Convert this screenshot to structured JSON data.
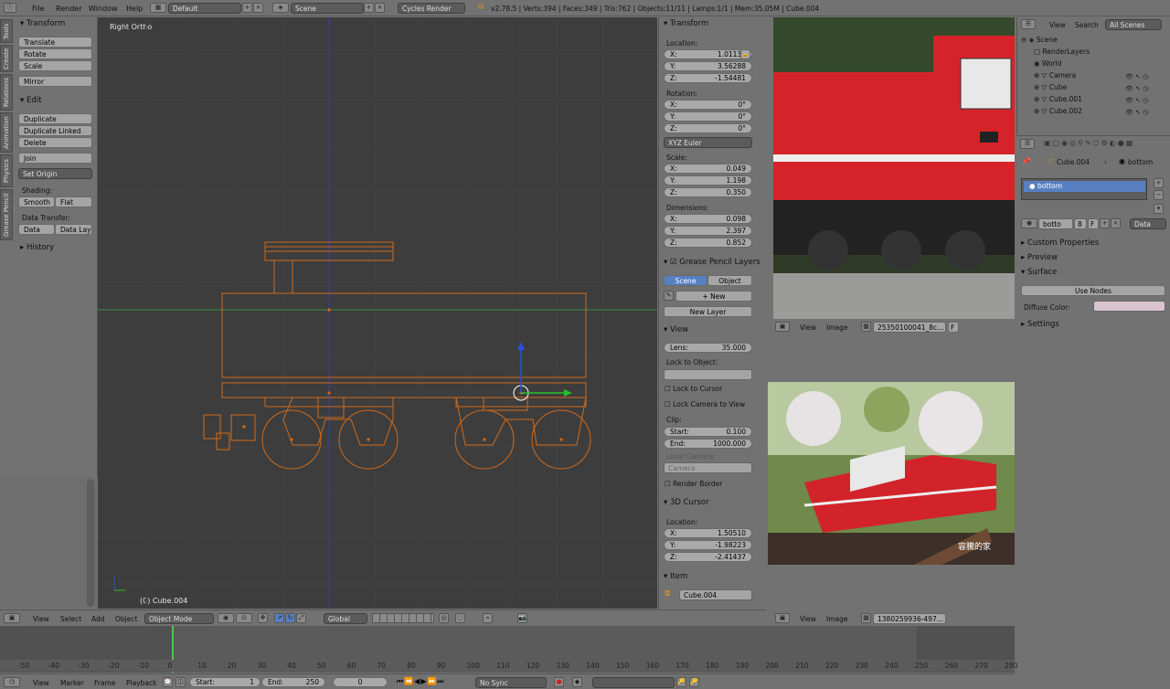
{
  "topbar": {
    "menus": [
      "File",
      "Render",
      "Window",
      "Help"
    ],
    "layout": "Default",
    "scene": "Scene",
    "engine": "Cycles Render",
    "stats": "v2.78.5 | Verts:394 | Faces:349 | Tris:762 | Objects:11/11 | Lamps:1/1 | Mem:35.05M | Cube.004"
  },
  "tools": {
    "tabs": [
      "Tools",
      "Create",
      "Relations",
      "Animation",
      "Physics",
      "Grease Pencil"
    ],
    "transform_header": "Transform",
    "translate": "Translate",
    "rotate": "Rotate",
    "scale": "Scale",
    "mirror": "Mirror",
    "edit_header": "Edit",
    "duplicate": "Duplicate",
    "duplicate_linked": "Duplicate Linked",
    "delete": "Delete",
    "join": "Join",
    "set_origin": "Set Origin",
    "shading_label": "Shading:",
    "smooth": "Smooth",
    "flat": "Flat",
    "data_transfer_label": "Data Transfer:",
    "data": "Data",
    "data_layout": "Data Layo",
    "history_header": "History"
  },
  "viewport": {
    "view_name": "Right Ortho",
    "object_label": "(0) Cube.004"
  },
  "properties_n": {
    "transform_header": "Transform",
    "location_label": "Location:",
    "loc_x": "1.01131",
    "loc_y": "3.56288",
    "loc_z": "-1.54481",
    "rotation_label": "Rotation:",
    "rot_x": "0°",
    "rot_y": "0°",
    "rot_z": "0°",
    "rot_mode": "XYZ Euler",
    "scale_label": "Scale:",
    "scale_x": "0.049",
    "scale_y": "1.198",
    "scale_z": "0.350",
    "dimensions_label": "Dimensions:",
    "dim_x": "0.098",
    "dim_y": "2.397",
    "dim_z": "0.852",
    "gp_layers": "Grease Pencil Layers",
    "gp_scene": "Scene",
    "gp_object": "Object",
    "gp_new": "New",
    "gp_new_layer": "New Layer",
    "view_header": "View",
    "lens_label": "Lens:",
    "lens": "35.000",
    "lock_to_object": "Lock to Object:",
    "lock_to_cursor": "Lock to Cursor",
    "lock_camera": "Lock Camera to View",
    "clip_label": "Clip:",
    "clip_start_label": "Start:",
    "clip_start": "0.100",
    "clip_end_label": "End:",
    "clip_end": "1000.000",
    "local_camera": "Local Camera:",
    "camera": "Camera",
    "render_border": "Render Border",
    "cursor_header": "3D Cursor",
    "cursor_location": "Location:",
    "cur_x": "1.50510",
    "cur_y": "-1.98223",
    "cur_z": "-2.41437",
    "item_header": "Item",
    "item_name": "Cube.004",
    "x": "X:",
    "y": "Y:",
    "z": "Z:"
  },
  "image_editors": {
    "top_file": "25350100041_8c...",
    "bottom_file": "1380259936-497...",
    "view": "View",
    "image": "Image",
    "f": "F",
    "watermark": "容騰的家"
  },
  "outliner": {
    "view": "View",
    "search": "Search",
    "all_scenes": "All Scenes",
    "rows": [
      "Scene",
      "RenderLayers",
      "World",
      "Camera",
      "Cube",
      "Cube.001",
      "Cube.002"
    ]
  },
  "material": {
    "crumb_object": "Cube.004",
    "crumb_material": "bottom",
    "slot": "bottom",
    "name_field": "botto",
    "users": "8",
    "f": "F",
    "data": "Data",
    "custom_props": "Custom Properties",
    "preview": "Preview",
    "surface": "Surface",
    "use_nodes": "Use Nodes",
    "diffuse_label": "Diffuse Color:",
    "settings": "Settings",
    "diffuse_color": "#d9c3cf"
  },
  "view3d_header": {
    "view": "View",
    "select": "Select",
    "add": "Add",
    "object": "Object",
    "mode": "Object Mode",
    "orientation": "Global"
  },
  "timeline": {
    "ticks": [
      "-50",
      "-40",
      "-30",
      "-20",
      "-10",
      "0",
      "10",
      "20",
      "30",
      "40",
      "50",
      "60",
      "70",
      "80",
      "90",
      "100",
      "110",
      "120",
      "130",
      "140",
      "150",
      "160",
      "170",
      "180",
      "190",
      "200",
      "210",
      "220",
      "230",
      "240",
      "250",
      "260",
      "270",
      "280"
    ],
    "view": "View",
    "marker": "Marker",
    "frame": "Frame",
    "playback": "Playback",
    "start_label": "Start:",
    "start": "1",
    "end_label": "End:",
    "end": "250",
    "current": "0",
    "sync": "No Sync"
  }
}
